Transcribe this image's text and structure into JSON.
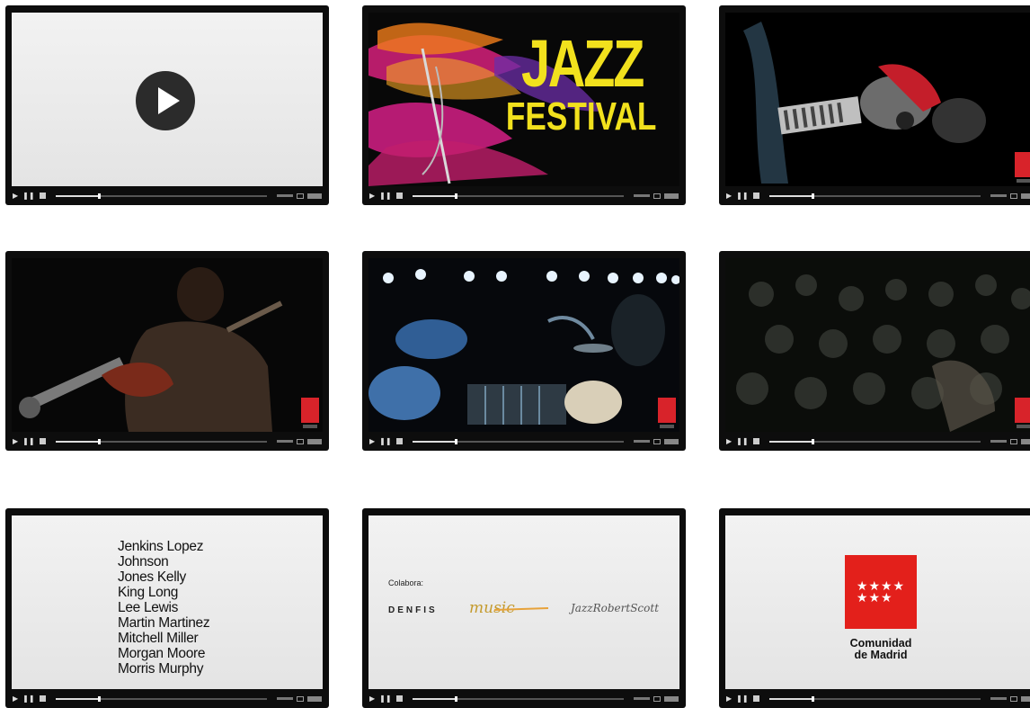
{
  "thumbnails": [
    {
      "title": "",
      "screen": "play"
    },
    {
      "title": "JAZZ",
      "subtitle": "FESTIVAL"
    },
    {
      "title": "",
      "screen": "guitar"
    },
    {
      "title": "",
      "screen": "trumpet"
    },
    {
      "title": "",
      "screen": "band"
    },
    {
      "title": "",
      "screen": "audience"
    },
    {
      "credits": [
        "Jenkins Lopez",
        "Johnson",
        "Jones Kelly",
        "King Long",
        "Lee Lewis",
        "Martin Martinez",
        "Mitchell Miller",
        "Morgan Moore",
        "Morris Murphy"
      ]
    },
    {
      "collab_label": "Colabora:",
      "sponsor1": "DENFIS",
      "sponsor2": "music",
      "sponsor3": "JazzRobertScott"
    },
    {
      "flag_stars": "★★★★\n★★★",
      "brand_line1": "Comunidad",
      "brand_line2": "de Madrid"
    }
  ],
  "colors": {
    "accent_red": "#d8232a",
    "jazz_yellow": "#f2e11d"
  }
}
